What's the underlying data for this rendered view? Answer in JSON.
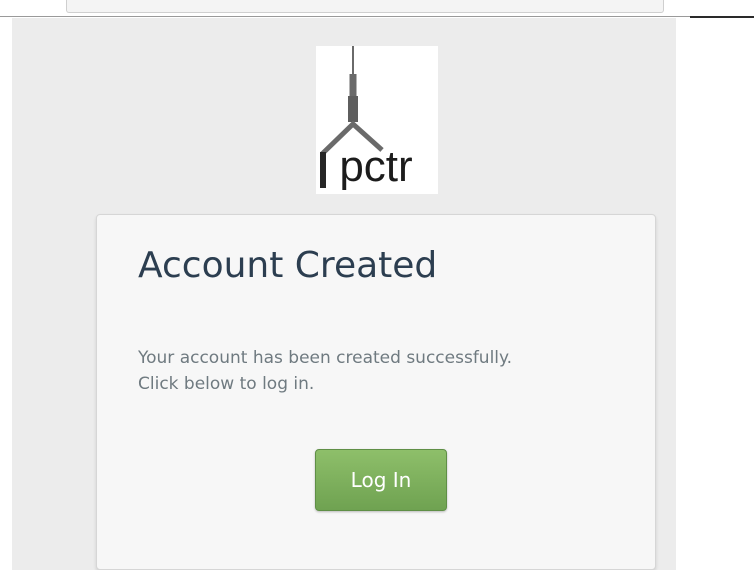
{
  "logo": {
    "text": "pctr",
    "icon": "church-steeple-icon"
  },
  "card": {
    "title": "Account Created",
    "message": "Your account has been created successfully. Click below to log in.",
    "login_label": "Log In"
  },
  "colors": {
    "panel_bg": "#ececec",
    "card_bg": "#f7f7f7",
    "title": "#2c3e50",
    "message": "#6f7a80",
    "button": "#7cae5b"
  }
}
